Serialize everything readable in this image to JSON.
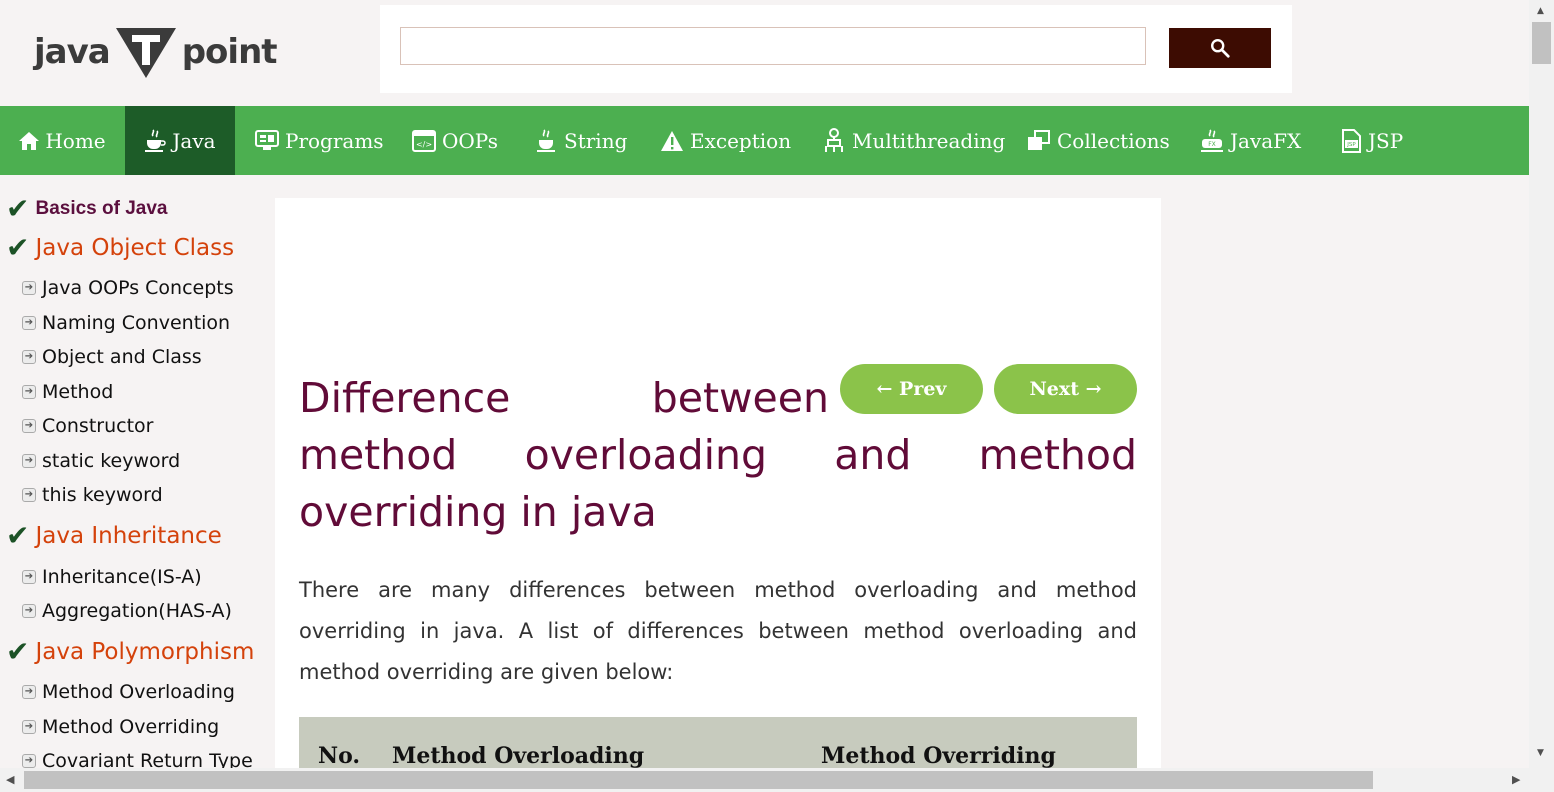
{
  "brand": {
    "logo_left": "java",
    "logo_mark": "T",
    "logo_right": "point"
  },
  "search": {
    "placeholder": "",
    "value": ""
  },
  "nav": {
    "items": [
      {
        "label": "Home",
        "icon": "home-icon"
      },
      {
        "label": "Java",
        "icon": "java-cup-icon",
        "active": true
      },
      {
        "label": "Programs",
        "icon": "programs-icon"
      },
      {
        "label": "OOPs",
        "icon": "oops-icon"
      },
      {
        "label": "String",
        "icon": "string-icon"
      },
      {
        "label": "Exception",
        "icon": "warning-icon"
      },
      {
        "label": "Multithreading",
        "icon": "multithreading-icon"
      },
      {
        "label": "Collections",
        "icon": "collections-icon"
      },
      {
        "label": "JavaFX",
        "icon": "javafx-icon"
      },
      {
        "label": "JSP",
        "icon": "jsp-icon"
      }
    ]
  },
  "sidebar": {
    "basics": "Basics of Java",
    "sections": [
      {
        "title": "Java Object Class",
        "links": [
          "Java OOPs Concepts",
          "Naming Convention",
          "Object and Class",
          "Method",
          "Constructor",
          "static keyword",
          "this keyword"
        ]
      },
      {
        "title": "Java Inheritance",
        "links": [
          "Inheritance(IS-A)",
          "Aggregation(HAS-A)"
        ]
      },
      {
        "title": "Java Polymorphism",
        "links": [
          "Method Overloading",
          "Method Overriding",
          "Covariant Return Type"
        ]
      }
    ]
  },
  "article": {
    "title_word1": "Difference",
    "title_word2": "between",
    "title_rest": "method overloading and method overriding in java",
    "prev_label": "← Prev",
    "next_label": "Next →",
    "intro": "There are many differences between method overloading and method overriding in java. A list of differences between method overloading and method overriding are given below:",
    "table_headers": [
      "No.",
      "Method Overloading",
      "Method Overriding"
    ]
  },
  "colors": {
    "nav_bg": "#4caf50",
    "nav_active": "#1d5c28",
    "title": "#610b38",
    "section_title": "#d4420b",
    "pager_button": "#8bc34a",
    "search_button": "#3d0c02"
  }
}
